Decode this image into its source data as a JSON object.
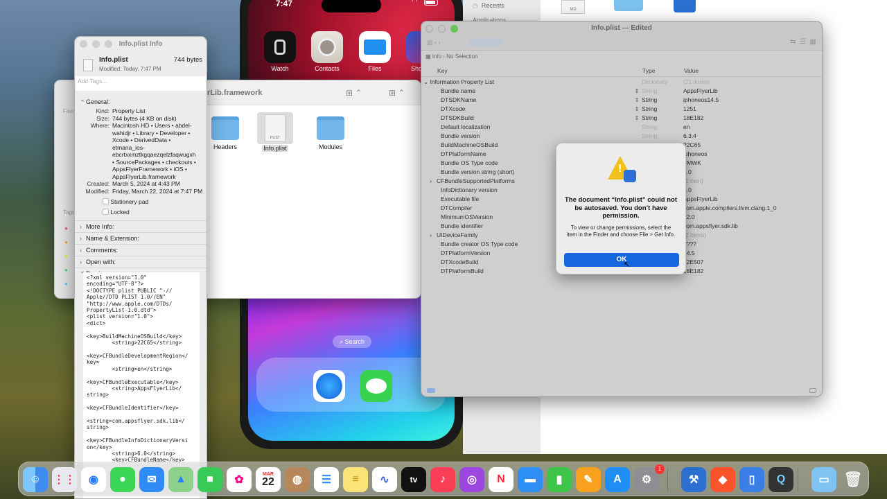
{
  "phone": {
    "time": "7:47",
    "apps": [
      {
        "label": "Watch",
        "icon": "watch-icon"
      },
      {
        "label": "Contacts",
        "icon": "contacts-icon"
      },
      {
        "label": "Files",
        "icon": "files-icon"
      },
      {
        "label": "Sho",
        "icon": "shortcuts-icon"
      }
    ],
    "search_label": "Search",
    "dock_apps": [
      "safari-icon",
      "messages-icon"
    ]
  },
  "info_window": {
    "title": "Info.plist Info",
    "file_name": "Info.plist",
    "file_size": "744 bytes",
    "modified_short": "Modified: Today, 7:47 PM",
    "tags_placeholder": "Add Tags...",
    "general_label": "General:",
    "details": [
      {
        "k": "Kind:",
        "v": "Property List"
      },
      {
        "k": "Size:",
        "v": "744 bytes (4 KB on disk)"
      },
      {
        "k": "Where:",
        "v": "Macintosh HD • Users • abdel-wahidjr • Library • Developer • Xcode • DerivedData • etmana_ios-ebcrtxxmztkgqaezqelzfaqwugxh • SourcePackages • checkouts • AppsFlyerFramework • iOS • AppsFlyerLib.framework"
      },
      {
        "k": "Created:",
        "v": "March 5, 2024 at 4:43 PM"
      },
      {
        "k": "Modified:",
        "v": "Friday, March 22, 2024 at 7:47 PM"
      }
    ],
    "stationery_label": "Stationery pad",
    "locked_label": "Locked",
    "sections": [
      "More Info:",
      "Name & Extension:",
      "Comments:",
      "Open with:"
    ],
    "preview_label": "Preview:",
    "preview_text": "<?xml version=\"1.0\"\nencoding=\"UTF-8\"?>\n<!DOCTYPE plist PUBLIC \"-//\nApple//DTD PLIST 1.0//EN\"\n\"http://www.apple.com/DTDs/\nPropertyList-1.0.dtd\">\n<plist version=\"1.0\">\n<dict>\n\n<key>BuildMachineOSBuild</key>\n        <string>22C65</string>\n\n<key>CFBundleDevelopmentRegion</\nkey>\n        <string>en</string>\n\n<key>CFBundleExecutable</key>\n        <string>AppsFlyerLib</\nstring>\n\n<key>CFBundleIdentifier</key>\n\n<string>com.appsflyer.sdk.lib</\nstring>\n\n<key>CFBundleInfoDictionaryVersi\non</key>\n        <string>6.0</string>\n        <key>CFBundleName</key>"
  },
  "finder": {
    "title": "rLib.framework",
    "sidebar_labels": [
      "Favo",
      "Tags"
    ],
    "items": [
      {
        "label": "Headers",
        "type": "folder"
      },
      {
        "label": "Info.plist",
        "type": "plist",
        "badge": "PLIST"
      },
      {
        "label": "Modules",
        "type": "folder"
      }
    ],
    "back_sidebar": {
      "recents": "Recents",
      "applications": "Applications"
    },
    "back_file_badge": "MD"
  },
  "plist_editor": {
    "title": "Info.plist — Edited",
    "breadcrumb_root": "Info",
    "breadcrumb_selection": "No Selection",
    "columns": {
      "key": "Key",
      "type": "Type",
      "value": "Value"
    },
    "root": {
      "key": "Information Property List",
      "type": "Dictionary",
      "value": "(21 items)"
    },
    "rows": [
      {
        "key": "Bundle name",
        "type": "String",
        "value": "AppsFlyerLib",
        "stepper": true
      },
      {
        "key": "DTSDKName",
        "type": "String",
        "value": "iphoneos14.5",
        "stepper": true
      },
      {
        "key": "DTXcode",
        "type": "String",
        "value": "1251",
        "stepper": true
      },
      {
        "key": "DTSDKBuild",
        "type": "String",
        "value": "18E182",
        "stepper": true
      },
      {
        "key": "Default localization",
        "type": "String",
        "value": "en"
      },
      {
        "key": "Bundle version",
        "type": "String",
        "value": "6.3.4"
      },
      {
        "key": "BuildMachineOSBuild",
        "type": "",
        "value": "22C65"
      },
      {
        "key": "DTPlatformName",
        "type": "",
        "value": "iphoneos"
      },
      {
        "key": "Bundle OS Type code",
        "type": "",
        "value": "FMWK"
      },
      {
        "key": "Bundle version string (short)",
        "type": "",
        "value": "6.0"
      },
      {
        "key": "CFBundleSupportedPlatforms",
        "type": "",
        "value": "(1 item)",
        "expand": true
      },
      {
        "key": "InfoDictionary version",
        "type": "",
        "value": "6.0"
      },
      {
        "key": "Executable file",
        "type": "",
        "value": "AppsFlyerLib"
      },
      {
        "key": "DTCompiler",
        "type": "",
        "value": "com.apple.compilers.llvm.clang.1_0"
      },
      {
        "key": "MinimumOSVersion",
        "type": "",
        "value": "12.0"
      },
      {
        "key": "Bundle identifier",
        "type": "",
        "value": "com.appsflyer.sdk.lib"
      },
      {
        "key": "UIDeviceFamily",
        "type": "",
        "value": "(2 items)",
        "expand": true
      },
      {
        "key": "Bundle creator OS Type code",
        "type": "",
        "value": "????"
      },
      {
        "key": "DTPlatformVersion",
        "type": "",
        "value": "14.5"
      },
      {
        "key": "DTXcodeBuild",
        "type": "",
        "value": "12E507"
      },
      {
        "key": "DTPlatformBuild",
        "type": "",
        "value": "18E182"
      }
    ]
  },
  "alert": {
    "title": "The document “Info.plist” could not be autosaved. You don’t have permission.",
    "message": "To view or change permissions, select the item in the Finder and choose File > Get Info.",
    "ok_label": "OK"
  },
  "dock": {
    "calendar_month": "MAR",
    "calendar_day": "22",
    "tv_label": "tv",
    "settings_badge": "1",
    "apps": [
      "finder-icon",
      "launchpad-icon",
      "safari-icon",
      "messages-icon",
      "mail-icon",
      "maps-icon",
      "facetime-icon",
      "photos-icon",
      "calendar-icon",
      "contacts-icon",
      "reminders-icon",
      "notes-icon",
      "freeform-icon",
      "tv-icon",
      "music-icon",
      "podcasts-icon",
      "news-icon",
      "keynote-icon",
      "numbers-icon",
      "pages-icon",
      "app-store-icon",
      "system-settings-icon",
      "xcode-icon",
      "brave-icon",
      "simulator-icon",
      "quicktime-icon",
      "downloads-folder-icon",
      "trash-icon"
    ]
  }
}
